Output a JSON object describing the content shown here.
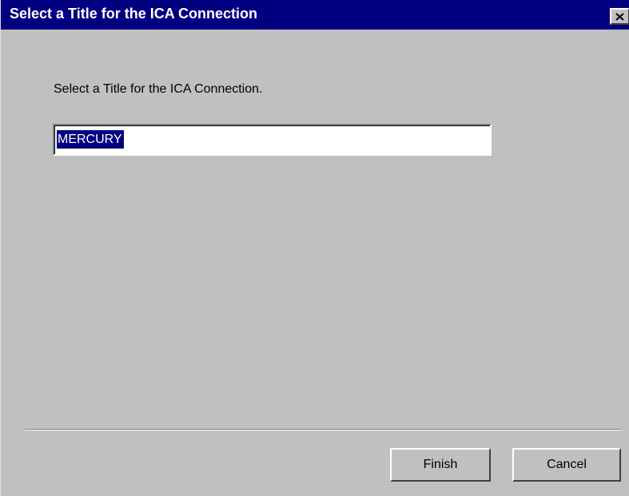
{
  "window": {
    "title": "Select a Title for the ICA Connection",
    "titlebar_color": "#000080",
    "background_color": "#c0c0c0",
    "close_icon": "close-icon"
  },
  "form": {
    "prompt": "Select a Title for the ICA Connection.",
    "title_value": "MERCURY",
    "title_selected": true,
    "selection_color": "#000080"
  },
  "buttons": {
    "finish_label": "Finish",
    "cancel_label": "Cancel"
  }
}
